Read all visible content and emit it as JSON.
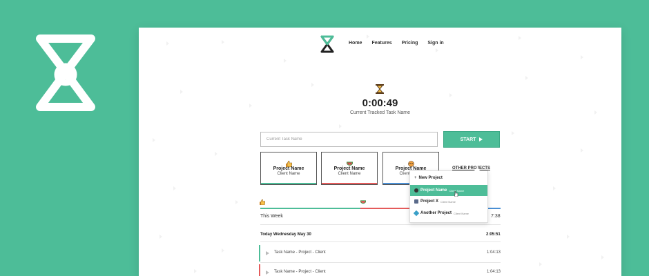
{
  "nav": {
    "items": [
      {
        "label": "Home"
      },
      {
        "label": "Features"
      },
      {
        "label": "Pricing"
      },
      {
        "label": "Sign in"
      }
    ]
  },
  "timer": {
    "elapsed": "0:00:49",
    "caption": "Current Tracked Task Name"
  },
  "task_input": {
    "placeholder": "Current Task Name",
    "value": ""
  },
  "start_button": {
    "label": "START",
    "icon": "play-icon"
  },
  "project_cards": [
    {
      "project": "Project Name",
      "client": "Client Name",
      "icon": "thumbs-up-icon",
      "bar_color": "#4dbd98"
    },
    {
      "project": "Project Name",
      "client": "Client Name",
      "icon": "watermelon-icon",
      "bar_color": "#e45b5b"
    },
    {
      "project": "Project Name",
      "client": "Client Name",
      "icon": "robot-icon",
      "bar_color": "#4a8fd4"
    }
  ],
  "other_projects": {
    "label": "OTHER PROJECTS"
  },
  "dropdown": {
    "new_project": "New Project",
    "items": [
      {
        "project": "Project Name",
        "client": "Client Name",
        "icon": "globe-icon",
        "active": true
      },
      {
        "project": "Project X",
        "client": "Client Name",
        "icon": "chart-icon",
        "active": false
      },
      {
        "project": "Another Project",
        "client": "Client Name",
        "icon": "diamond-icon",
        "active": false
      }
    ]
  },
  "week": {
    "label": "This Week",
    "total": "7:38",
    "segments": [
      {
        "color": "#4dbd98",
        "icon": "thumbs-up-icon"
      },
      {
        "color": "#e45b5b",
        "icon": "watermelon-icon"
      },
      {
        "color": "#4a8fd4",
        "icon": ""
      }
    ]
  },
  "day": {
    "label": "Today Wednesday May 30",
    "total": "2:05:51"
  },
  "entries": [
    {
      "name": "Task Name - Project - Client",
      "duration": "1:04:13",
      "color": "#4dbd98"
    },
    {
      "name": "Task Name - Project - Client",
      "duration": "1:04:13",
      "color": "#e45b5b"
    }
  ],
  "colors": {
    "brand": "#4dbd98",
    "red": "#e45b5b",
    "blue": "#4a8fd4",
    "dark": "#222222"
  }
}
